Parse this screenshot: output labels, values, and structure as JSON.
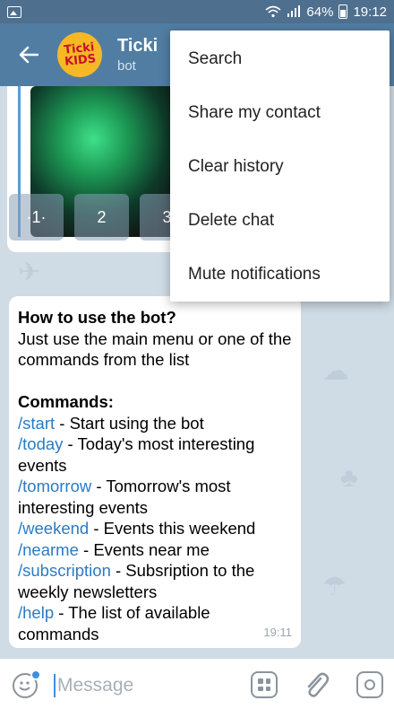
{
  "status_bar": {
    "battery": "64%",
    "time": "19:12",
    "signal": "wifi-signal-icons"
  },
  "header": {
    "avatar_line1": "Ticki",
    "avatar_line2": "KIDS",
    "title": "Ticki",
    "subtitle": "bot"
  },
  "keyboard_buttons": [
    "·1·",
    "2",
    "3"
  ],
  "message": {
    "heading": "How to use the bot?",
    "intro": "Just use the main menu or one of the commands from the list",
    "commands_title": "Commands:",
    "commands": [
      {
        "cmd": "/start",
        "desc": " - Start using the bot"
      },
      {
        "cmd": "/today",
        "desc": " - Today's most interesting events"
      },
      {
        "cmd": "/tomorrow",
        "desc": " - Tomorrow's most interesting events"
      },
      {
        "cmd": "/weekend",
        "desc": " - Events this weekend"
      },
      {
        "cmd": "/nearme",
        "desc": " - Events near me"
      },
      {
        "cmd": "/subscription",
        "desc": " - Subsription to the weekly newsletters"
      },
      {
        "cmd": "/help",
        "desc": " - The list of available commands"
      }
    ],
    "time": "19:11"
  },
  "menu": {
    "items": [
      "Search",
      "Share my contact",
      "Clear history",
      "Delete chat",
      "Mute notifications"
    ]
  },
  "input": {
    "placeholder": "Message"
  },
  "colors": {
    "header": "#517da2",
    "status": "#4f6f8f",
    "link": "#2a7bc4",
    "chat_bg": "#cfdbe5"
  }
}
